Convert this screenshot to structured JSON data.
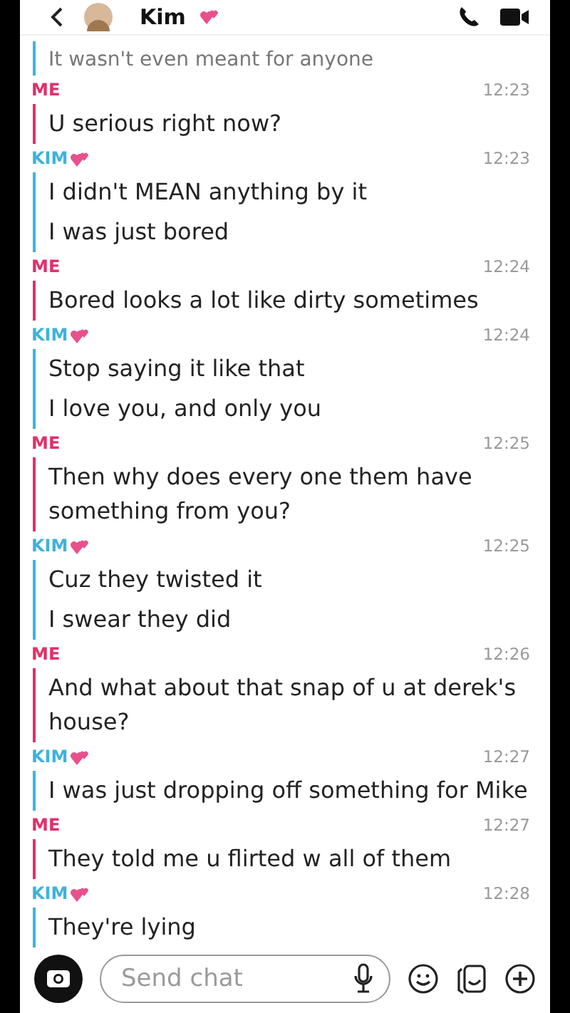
{
  "header": {
    "name": "Kim"
  },
  "cut_message": {
    "text": "It wasn't even meant for anyone",
    "kind": "friend"
  },
  "messages": [
    {
      "sender": "ME",
      "kind": "me",
      "time": "12:23",
      "lines": [
        "U serious right now?"
      ]
    },
    {
      "sender": "KIM",
      "kind": "friend",
      "time": "12:23",
      "lines": [
        "I didn't MEAN anything by it",
        "I was just bored"
      ]
    },
    {
      "sender": "ME",
      "kind": "me",
      "time": "12:24",
      "lines": [
        "Bored looks a lot like dirty sometimes"
      ]
    },
    {
      "sender": "KIM",
      "kind": "friend",
      "time": "12:24",
      "lines": [
        "Stop saying it like that",
        "I love you, and only you"
      ]
    },
    {
      "sender": "ME",
      "kind": "me",
      "time": "12:25",
      "lines": [
        "Then why does every one them have something from you?"
      ]
    },
    {
      "sender": "KIM",
      "kind": "friend",
      "time": "12:25",
      "lines": [
        "Cuz they twisted it",
        "I swear they did"
      ]
    },
    {
      "sender": "ME",
      "kind": "me",
      "time": "12:26",
      "lines": [
        "And what about that snap of u at derek's house?"
      ]
    },
    {
      "sender": "KIM",
      "kind": "friend",
      "time": "12:27",
      "lines": [
        "I was  just dropping off something for Mike"
      ]
    },
    {
      "sender": "ME",
      "kind": "me",
      "time": "12:27",
      "lines": [
        "They told me u flirted w all of them"
      ]
    },
    {
      "sender": "KIM",
      "kind": "friend",
      "time": "12:28",
      "lines": [
        "They're lying"
      ]
    }
  ],
  "composer": {
    "placeholder": "Send chat"
  }
}
